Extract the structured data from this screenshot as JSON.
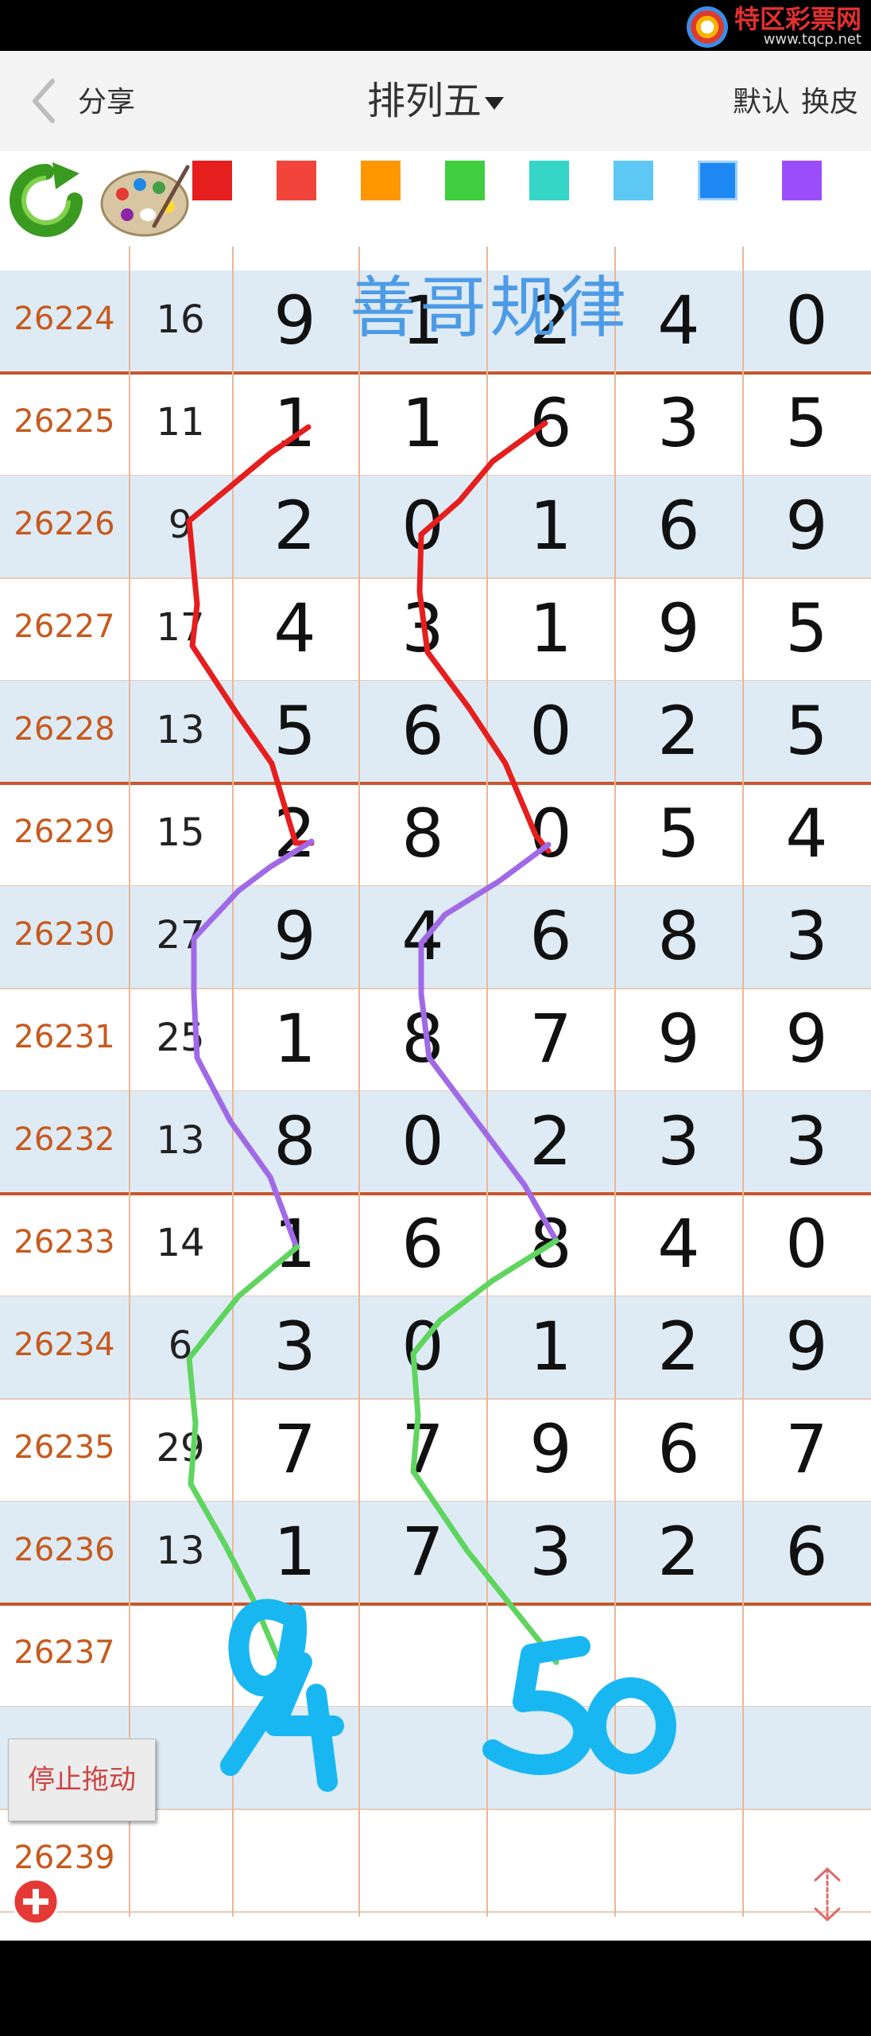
{
  "logo": {
    "name": "特区彩票网",
    "url": "www.tqcp.net"
  },
  "header": {
    "share_label": "分享",
    "title": "排列五",
    "right_links": [
      "默认",
      "换皮"
    ]
  },
  "toolbar": {
    "colors": [
      "#e51e1e",
      "#f2443a",
      "#ff9800",
      "#3fce3f",
      "#35d6c8",
      "#5ec8f5",
      "#1e88f2",
      "#9b4dfb"
    ],
    "icons": [
      "refresh-icon",
      "palette-icon"
    ]
  },
  "rows": [
    {
      "issue": "26224",
      "sum": "16",
      "digits": [
        "9",
        "1",
        "2",
        "4",
        "0"
      ]
    },
    {
      "issue": "26225",
      "sum": "11",
      "digits": [
        "1",
        "1",
        "6",
        "3",
        "5"
      ]
    },
    {
      "issue": "26226",
      "sum": "9",
      "digits": [
        "2",
        "0",
        "1",
        "6",
        "9"
      ]
    },
    {
      "issue": "26227",
      "sum": "17",
      "digits": [
        "4",
        "3",
        "1",
        "9",
        "5"
      ]
    },
    {
      "issue": "26228",
      "sum": "13",
      "digits": [
        "5",
        "6",
        "0",
        "2",
        "5"
      ]
    },
    {
      "issue": "26229",
      "sum": "15",
      "digits": [
        "2",
        "8",
        "0",
        "5",
        "4"
      ]
    },
    {
      "issue": "26230",
      "sum": "27",
      "digits": [
        "9",
        "4",
        "6",
        "8",
        "3"
      ]
    },
    {
      "issue": "26231",
      "sum": "25",
      "digits": [
        "1",
        "8",
        "7",
        "9",
        "9"
      ]
    },
    {
      "issue": "26232",
      "sum": "13",
      "digits": [
        "8",
        "0",
        "2",
        "3",
        "3"
      ]
    },
    {
      "issue": "26233",
      "sum": "14",
      "digits": [
        "1",
        "6",
        "8",
        "4",
        "0"
      ]
    },
    {
      "issue": "26234",
      "sum": "6",
      "digits": [
        "3",
        "0",
        "1",
        "2",
        "9"
      ]
    },
    {
      "issue": "26235",
      "sum": "29",
      "digits": [
        "7",
        "7",
        "9",
        "6",
        "7"
      ]
    },
    {
      "issue": "26236",
      "sum": "13",
      "digits": [
        "1",
        "7",
        "3",
        "2",
        "6"
      ]
    },
    {
      "issue": "26237",
      "sum": "",
      "digits": [
        "",
        "",
        "",
        "",
        ""
      ]
    },
    {
      "issue": "",
      "sum": "",
      "digits": [
        "",
        "",
        "",
        "",
        ""
      ]
    },
    {
      "issue": "26239",
      "sum": "",
      "digits": [
        "",
        "",
        "",
        "",
        ""
      ]
    }
  ],
  "watermark": "善哥规律",
  "handwriting": [
    "94",
    "50"
  ],
  "stop_drag_label": "停止拖动",
  "icons": [
    "back-chevron-icon",
    "plus-icon",
    "up-down-arrows-icon"
  ]
}
